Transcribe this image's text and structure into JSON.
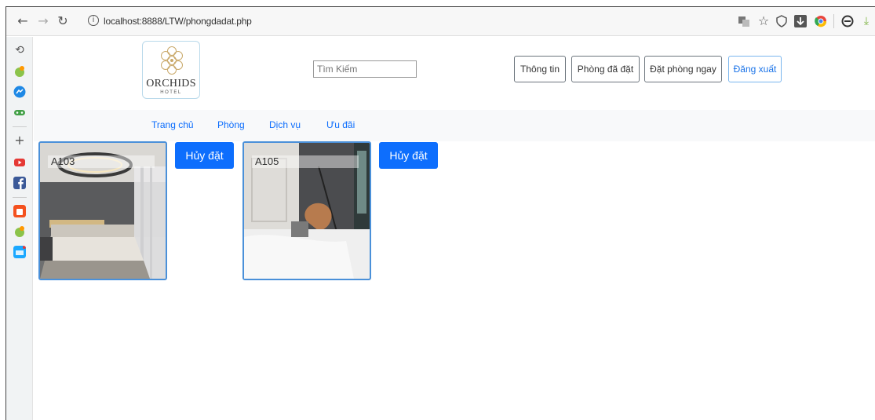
{
  "browser": {
    "url": "localhost:8888/LTW/phongdadat.php",
    "icons": [
      "back-arrow-icon",
      "forward-arrow-icon",
      "reload-icon",
      "info-icon",
      "translate-icon",
      "star-icon",
      "shield-icon",
      "download-box-icon",
      "chrome-ext-icon",
      "account-icon",
      "download-icon"
    ]
  },
  "sidebar": {
    "icons": [
      "history-icon",
      "chat-ext-icon",
      "messenger-icon",
      "game-icon",
      "add-icon",
      "youtube-icon",
      "facebook-icon",
      "shopee-icon",
      "chat-ext-icon-2",
      "tiki-icon"
    ]
  },
  "header": {
    "logo_text": "ORCHIDS",
    "logo_sub": "HOTEL",
    "search_placeholder": "Tìm Kiếm",
    "buttons": {
      "info": "Thông tin",
      "booked": "Phòng đã đặt",
      "book_now": "Đặt phòng ngay",
      "logout": "Đăng xuất"
    }
  },
  "nav": {
    "home": "Trang chủ",
    "rooms": "Phòng",
    "services": "Dịch vụ",
    "offers": "Ưu đãi"
  },
  "rooms": [
    {
      "name": "A103",
      "cancel_label": "Hủy đặt"
    },
    {
      "name": "A105",
      "cancel_label": "Hủy đặt"
    }
  ],
  "colors": {
    "primary": "#0d6efd",
    "nav_bg": "#f8f9fa",
    "card_border": "#4a90d9"
  }
}
